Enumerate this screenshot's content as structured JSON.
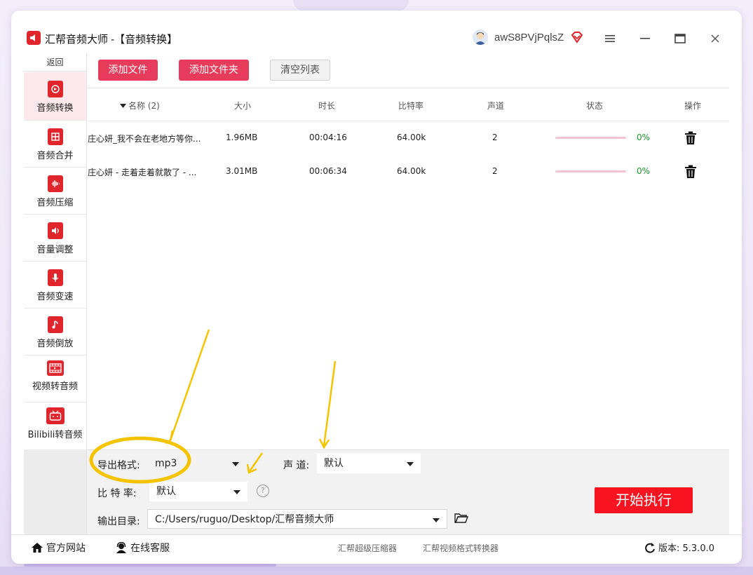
{
  "app": {
    "title": "汇帮音频大师 -【音频转换】",
    "username": "awS8PVjPqlsZ"
  },
  "sidebar": {
    "back_label": "返回",
    "items": [
      {
        "label": "音频转换",
        "icon": "audio-convert-icon",
        "active": true
      },
      {
        "label": "音频合并",
        "icon": "audio-merge-icon"
      },
      {
        "label": "音频压缩",
        "icon": "audio-compress-icon"
      },
      {
        "label": "音量调整",
        "icon": "volume-icon"
      },
      {
        "label": "音频变速",
        "icon": "microphone-icon"
      },
      {
        "label": "音频倒放",
        "icon": "music-note-icon"
      },
      {
        "label": "视频转音频",
        "icon": "film-icon"
      },
      {
        "label": "Bilibili转音频",
        "icon": "tv-icon"
      }
    ]
  },
  "toolbar": {
    "add_file": "添加文件",
    "add_folder": "添加文件夹",
    "clear_list": "清空列表"
  },
  "table": {
    "headers": {
      "name": "名称 (2)",
      "size": "大小",
      "duration": "时长",
      "bitrate": "比特率",
      "channels": "声道",
      "status": "状态",
      "action": "操作"
    },
    "rows": [
      {
        "name": "庄心妍_我不会在老地方等你...",
        "size": "1.96MB",
        "duration": "00:04:16",
        "bitrate": "64.00k",
        "channels": "2",
        "progress": 0,
        "progress_text": "0%"
      },
      {
        "name": "庄心妍 - 走着走着就散了 - ...",
        "size": "3.01MB",
        "duration": "00:06:34",
        "bitrate": "64.00k",
        "channels": "2",
        "progress": 0,
        "progress_text": "0%"
      }
    ]
  },
  "settings": {
    "format_label": "导出格式:",
    "format_value": "mp3",
    "channel_label": "声 道:",
    "channel_value": "默认",
    "bitrate_label": "比 特 率:",
    "bitrate_value": "默认",
    "help_glyph": "?",
    "output_label": "输出目录:",
    "output_value": "C:/Users/ruguo/Desktop/汇帮音频大师",
    "start_button": "开始执行"
  },
  "statusbar": {
    "website": "官方网站",
    "support": "在线客服",
    "link_compressor": "汇帮超级压缩器",
    "link_video_converter": "汇帮视频格式转换器",
    "version": "版本: 5.3.0.0"
  },
  "colors": {
    "brand_red": "#e0252d",
    "button_pink": "#e63b5a",
    "start_red": "#f5141f",
    "annotation_yellow": "#f5c400",
    "progress_green": "#1a9a2b"
  }
}
